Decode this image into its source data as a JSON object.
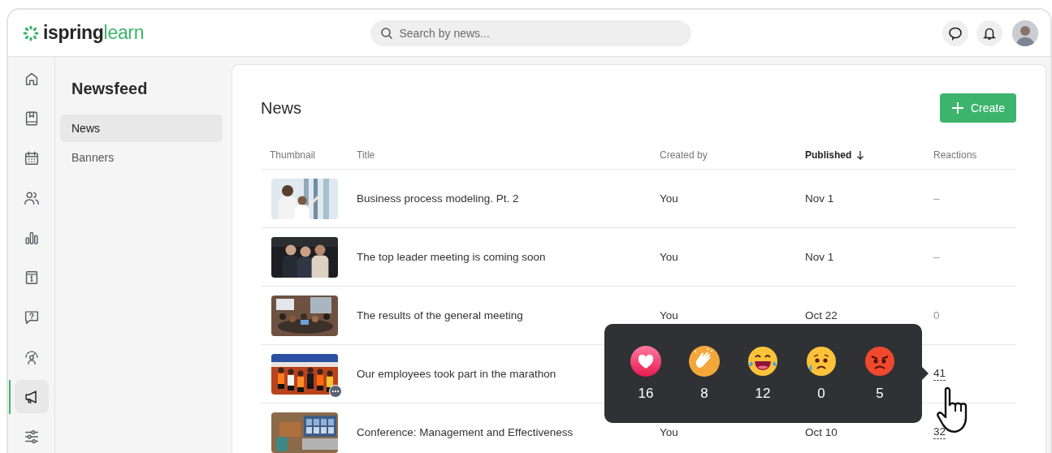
{
  "header": {
    "logo": {
      "text_1": "ispring",
      "text_2": "learn"
    },
    "search": {
      "placeholder": "Search by news..."
    }
  },
  "rail": [
    {
      "kind": "home",
      "selected": false
    },
    {
      "kind": "book",
      "selected": false
    },
    {
      "kind": "calendar",
      "selected": false
    },
    {
      "kind": "people",
      "selected": false
    },
    {
      "kind": "chart",
      "selected": false
    },
    {
      "kind": "info",
      "selected": false
    },
    {
      "kind": "question",
      "selected": false
    },
    {
      "kind": "gauge",
      "selected": false
    },
    {
      "kind": "megaphone",
      "selected": true
    },
    {
      "kind": "sliders",
      "selected": false
    }
  ],
  "sidebar": {
    "title": "Newsfeed",
    "items": [
      {
        "label": "News",
        "selected": true
      },
      {
        "label": "Banners",
        "selected": false
      }
    ]
  },
  "main": {
    "title": "News",
    "create_button": {
      "label": "Create"
    },
    "table": {
      "columns": [
        {
          "label": "Thumbnail",
          "sorted": false
        },
        {
          "label": "Title",
          "sorted": false
        },
        {
          "label": "Created by",
          "sorted": false
        },
        {
          "label": "Published",
          "sorted": true
        },
        {
          "label": "Reactions",
          "sorted": false
        }
      ],
      "rows": [
        {
          "title": "Business process modeling. Pt. 2",
          "created_by": "You",
          "published": "Nov 1",
          "reactions": "–",
          "reactions_link": false,
          "menu_badge": false
        },
        {
          "title": "The top leader meeting is coming soon",
          "created_by": "You",
          "published": "Nov 1",
          "reactions": "–",
          "reactions_link": false,
          "menu_badge": false
        },
        {
          "title": "The results of the general meeting",
          "created_by": "You",
          "published": "Oct 22",
          "reactions": "0",
          "reactions_link": false,
          "menu_badge": false
        },
        {
          "title": "Our employees took part in the marathon",
          "reactions": "41",
          "reactions_link": true,
          "menu_badge": true
        },
        {
          "title": "Conference: Management and Effectiveness",
          "created_by": "You",
          "published": "Oct 10",
          "reactions": "32",
          "reactions_link": true,
          "menu_badge": false
        }
      ]
    }
  },
  "reactions_popover": {
    "items": [
      {
        "kind": "heart",
        "count": "16"
      },
      {
        "kind": "clap",
        "count": "8"
      },
      {
        "kind": "laugh",
        "count": "12"
      },
      {
        "kind": "sad",
        "count": "0"
      },
      {
        "kind": "angry",
        "count": "5"
      }
    ]
  }
}
